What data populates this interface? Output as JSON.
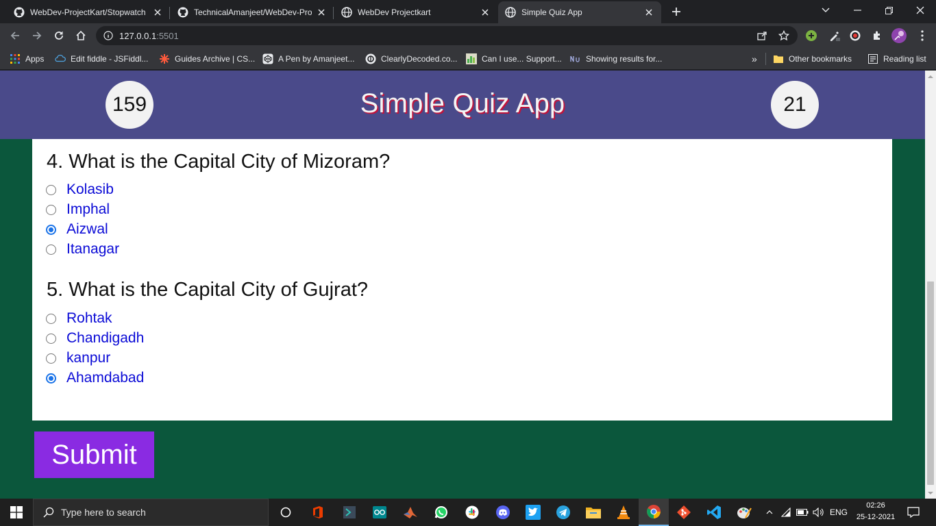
{
  "browser": {
    "tabs": [
      {
        "title": "WebDev-ProjectKart/Stopwatch at",
        "icon": "github-icon"
      },
      {
        "title": "TechnicalAmanjeet/WebDev-Proj",
        "icon": "github-icon"
      },
      {
        "title": "WebDev Projectkart",
        "icon": "globe-icon"
      },
      {
        "title": "Simple Quiz App",
        "icon": "globe-icon",
        "active": true
      }
    ],
    "address": {
      "host": "127.0.0.1",
      "port": ":5501"
    },
    "bookmarks": [
      {
        "label": "Apps",
        "icon": "apps-grid-icon"
      },
      {
        "label": "Edit fiddle - JSFiddl...",
        "icon": "jsfiddle-icon"
      },
      {
        "label": "Guides Archive | CS...",
        "icon": "css-tricks-icon"
      },
      {
        "label": "A Pen by Amanjeet...",
        "icon": "codepen-icon"
      },
      {
        "label": "ClearlyDecoded.co...",
        "icon": "clearlydecoded-icon"
      },
      {
        "label": "Can I use... Support...",
        "icon": "caniuse-icon"
      },
      {
        "label": "Showing results for...",
        "icon": "search-results-icon"
      }
    ],
    "bookmarks_overflow": "»",
    "other_bookmarks": "Other bookmarks",
    "reading_list": "Reading list"
  },
  "quiz": {
    "title": "Simple Quiz App",
    "left_counter": "159",
    "right_counter": "21",
    "questions": [
      {
        "text": "4. What is the Capital City of Mizoram?",
        "options": [
          "Kolasib",
          "Imphal",
          "Aizwal",
          "Itanagar"
        ],
        "selected": "Aizwal"
      },
      {
        "text": "5. What is the Capital City of Gujrat?",
        "options": [
          "Rohtak",
          "Chandigadh",
          "kanpur",
          "Ahamdabad"
        ],
        "selected": "Ahamdabad"
      }
    ],
    "submit_label": "Submit"
  },
  "taskbar": {
    "search_placeholder": "Type here to search",
    "apps": [
      "task-view-icon",
      "office-icon",
      "powershell-icon",
      "arduino-icon",
      "matlab-icon",
      "whatsapp-icon",
      "slack-icon",
      "discord-icon",
      "twitter-icon",
      "telegram-icon",
      "file-explorer-icon",
      "vlc-icon",
      "chrome-icon",
      "git-icon",
      "vscode-icon",
      "paint-icon"
    ],
    "language": "ENG",
    "time": "02:26",
    "date": "25-12-2021"
  },
  "colors": {
    "header_bg": "#4a4a8a",
    "page_bg": "#0b573c",
    "submit_bg": "#8a2be2",
    "option_text": "#0a0ad6",
    "title_shadow": "#c0143c"
  }
}
